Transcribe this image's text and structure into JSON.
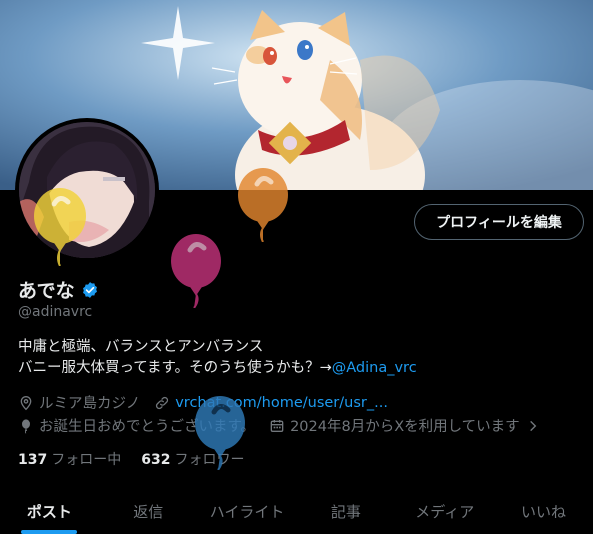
{
  "profile": {
    "display_name": "あでな",
    "handle": "@adinavrc",
    "bio_line1": "中庸と極端、バランスとアンバランス",
    "bio_line2_text": "バニー服大体買ってます。そのうち使うかも？→",
    "bio_link": "@Adina_vrc",
    "location": "ルミア島カジノ",
    "website": "vrchat.com/home/user/usr_...",
    "birthday": "お誕生日おめでとうございます。",
    "joined": "2024年8月からXを利用しています",
    "following_count": "137",
    "following_label": "フォロー中",
    "followers_count": "632",
    "followers_label": "フォロワー"
  },
  "actions": {
    "edit_profile": "プロフィールを編集"
  },
  "tabs": [
    {
      "label": "ポスト",
      "active": true
    },
    {
      "label": "返信"
    },
    {
      "label": "ハイライト"
    },
    {
      "label": "記事"
    },
    {
      "label": "メディア"
    },
    {
      "label": "いいね"
    }
  ],
  "colors": {
    "accent": "#1d9bf0",
    "verified": "#1d9bf0",
    "background": "#000000"
  },
  "balloons": [
    "#f2d33a",
    "#c2327a",
    "#e3872f",
    "#2f7ab8"
  ]
}
